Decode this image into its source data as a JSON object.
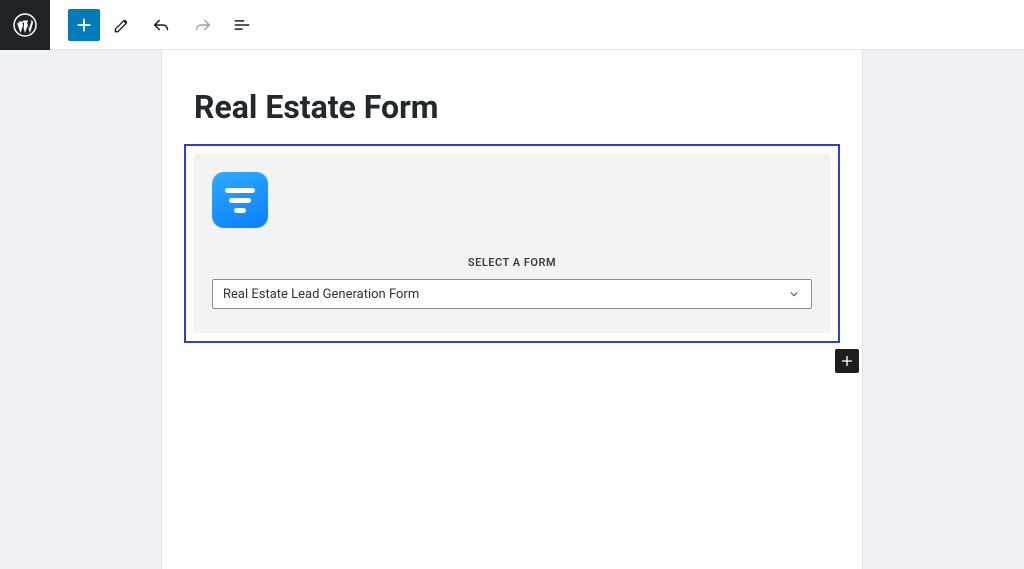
{
  "post": {
    "title": "Real Estate Form"
  },
  "block": {
    "select_label": "SELECT A FORM",
    "selected_value": "Real Estate Lead Generation Form"
  }
}
